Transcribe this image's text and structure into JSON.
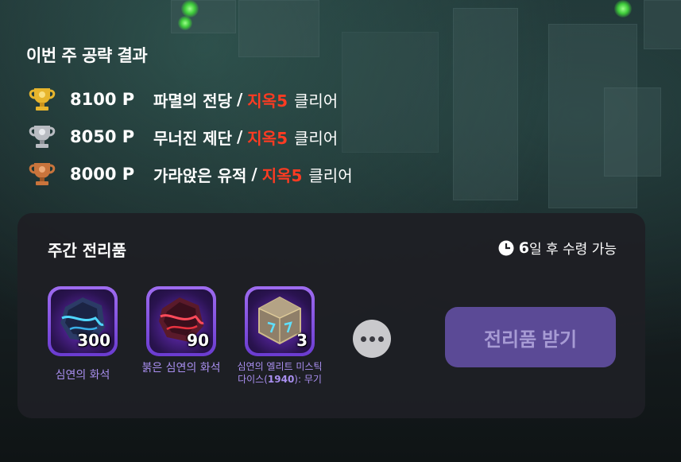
{
  "results": {
    "title": "이번 주 공략 결과",
    "rows": [
      {
        "rank": "gold",
        "points": "8100 P",
        "dungeon": "파멸의 전당",
        "separator": "/",
        "difficulty": "지옥5",
        "status": "클리어"
      },
      {
        "rank": "silver",
        "points": "8050 P",
        "dungeon": "무너진 제단",
        "separator": "/",
        "difficulty": "지옥5",
        "status": "클리어"
      },
      {
        "rank": "bronze",
        "points": "8000 P",
        "dungeon": "가라앉은 유적",
        "separator": "/",
        "difficulty": "지옥5",
        "status": "클리어"
      }
    ]
  },
  "rewards": {
    "title": "주간 전리품",
    "timer_number": "6",
    "timer_text": "일 후 수령 가능",
    "items": [
      {
        "name": "심연의 화석",
        "count": "300",
        "icon": "abyss-fossil-icon"
      },
      {
        "name": "붉은 심연의 화석",
        "count": "90",
        "icon": "red-abyss-fossil-icon"
      },
      {
        "name_line1": "심연의 엘리트 미스틱",
        "name_line2_a": "다이스(",
        "name_line2_b": "1940",
        "name_line2_c": "): 무기",
        "count": "3",
        "icon": "mystic-dice-icon"
      }
    ],
    "claim_label": "전리품 받기"
  },
  "colors": {
    "difficulty": "#ff3b22",
    "panel": "#1e1f24",
    "reward_frame": "#8a5ae6",
    "reward_label": "#a98ff0",
    "claim_button": "#5b4a96"
  }
}
